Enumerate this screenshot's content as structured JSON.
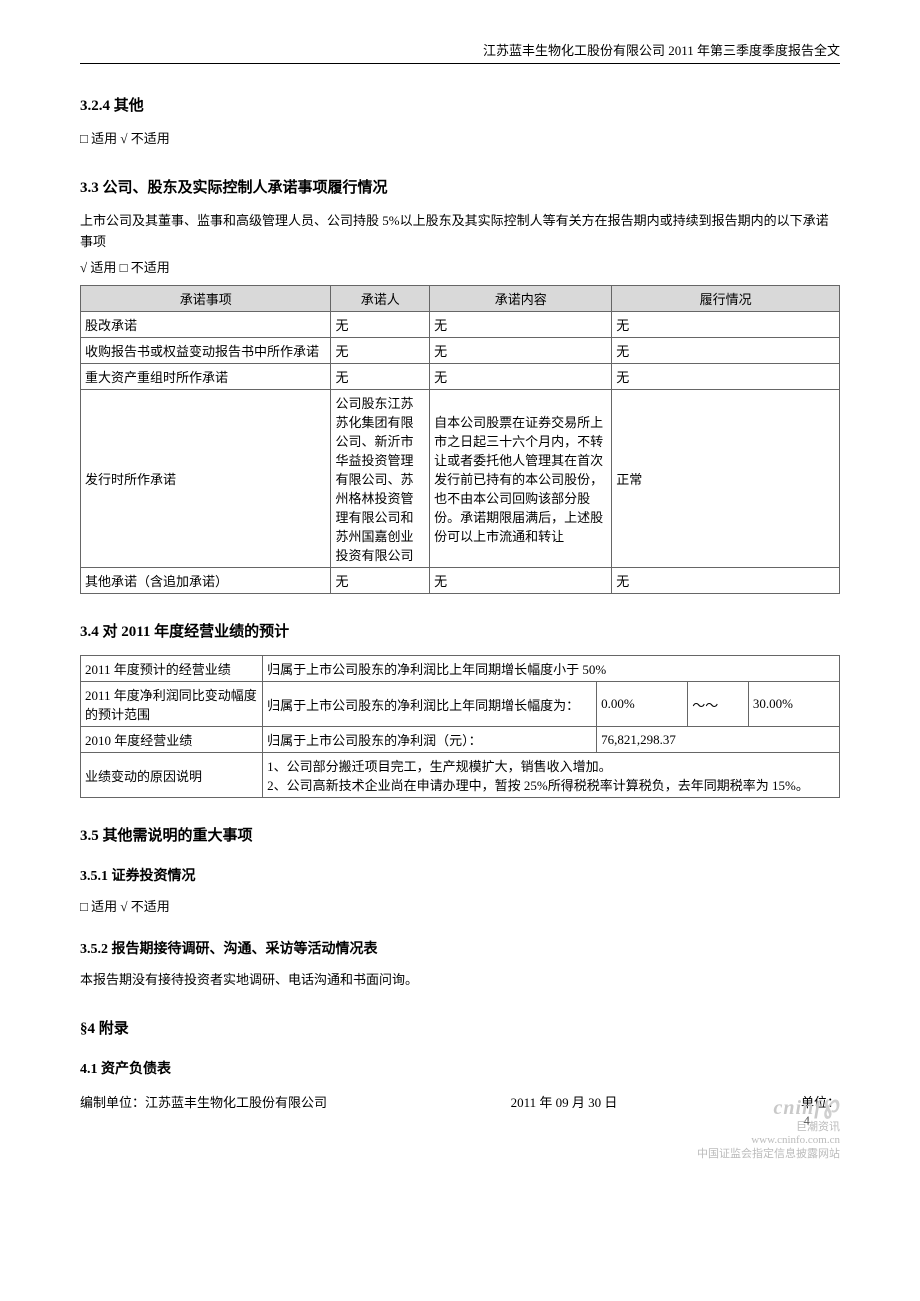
{
  "header": "江苏蓝丰生物化工股份有限公司 2011 年第三季度季度报告全文",
  "sec_324": {
    "title": "3.2.4 其他",
    "note": "□ 适用 √ 不适用"
  },
  "sec_33": {
    "title": "3.3 公司、股东及实际控制人承诺事项履行情况",
    "intro": "上市公司及其董事、监事和高级管理人员、公司持股 5%以上股东及其实际控制人等有关方在报告期内或持续到报告期内的以下承诺事项",
    "applicable": "√ 适用 □ 不适用",
    "headers": [
      "承诺事项",
      "承诺人",
      "承诺内容",
      "履行情况"
    ],
    "rows": [
      {
        "item": "股改承诺",
        "person": "无",
        "content": "无",
        "status": "无"
      },
      {
        "item": "收购报告书或权益变动报告书中所作承诺",
        "person": "无",
        "content": "无",
        "status": "无"
      },
      {
        "item": "重大资产重组时所作承诺",
        "person": "无",
        "content": "无",
        "status": "无"
      },
      {
        "item": "发行时所作承诺",
        "person": "公司股东江苏苏化集团有限公司、新沂市华益投资管理有限公司、苏州格林投资管理有限公司和苏州国嘉创业投资有限公司",
        "content": "自本公司股票在证券交易所上市之日起三十六个月内，不转让或者委托他人管理其在首次发行前已持有的本公司股份，也不由本公司回购该部分股份。承诺期限届满后，上述股份可以上市流通和转让",
        "status": "正常"
      },
      {
        "item": "其他承诺（含追加承诺）",
        "person": "无",
        "content": "无",
        "status": "无"
      }
    ]
  },
  "sec_34": {
    "title": "3.4 对 2011 年度经营业绩的预计",
    "rows": {
      "r1_label": "2011 年度预计的经营业绩",
      "r1_value": "归属于上市公司股东的净利润比上年同期增长幅度小于 50%",
      "r2_label": "2011 年度净利润同比变动幅度的预计范围",
      "r2_value": "归属于上市公司股东的净利润比上年同期增长幅度为：",
      "r2_min": "0.00%",
      "r2_sep": "～～",
      "r2_max": "30.00%",
      "r3_label": "2010 年度经营业绩",
      "r3_value": "归属于上市公司股东的净利润（元）：",
      "r3_amount": "76,821,298.37",
      "r4_label": "业绩变动的原因说明",
      "r4_value": "1、公司部分搬迁项目完工，生产规模扩大，销售收入增加。\n2、公司高新技术企业尚在申请办理中，暂按 25%所得税税率计算税负，去年同期税率为 15%。"
    }
  },
  "sec_35": {
    "title": "3.5 其他需说明的重大事项"
  },
  "sec_351": {
    "title": "3.5.1 证券投资情况",
    "note": "□ 适用 √ 不适用"
  },
  "sec_352": {
    "title": "3.5.2 报告期接待调研、沟通、采访等活动情况表",
    "note": "本报告期没有接待投资者实地调研、电话沟通和书面问询。"
  },
  "sec_4": {
    "title": "§4  附录"
  },
  "sec_41": {
    "title": "4.1 资产负债表",
    "compiler": "编制单位：江苏蓝丰生物化工股份有限公司",
    "date": "2011 年 09 月 30 日",
    "unit": "单位："
  },
  "page_number": "4",
  "watermark": {
    "logo_main": "cninf",
    "logo_sub": "巨潮资讯",
    "logo_url": "www.cninfo.com.cn",
    "logo_desc": "中国证监会指定信息披露网站"
  }
}
